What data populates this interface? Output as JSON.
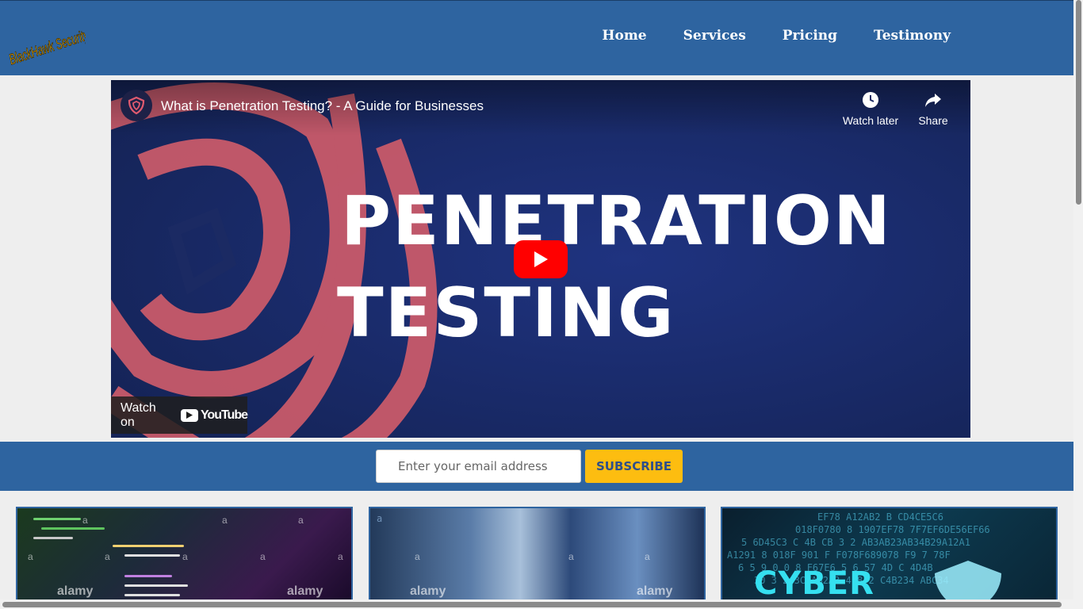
{
  "header": {
    "logo_text": "BlackHawk Security",
    "nav": [
      "Home",
      "Services",
      "Pricing",
      "Testimony"
    ]
  },
  "video": {
    "title": "What is Penetration Testing? - A Guide for Businesses",
    "watch_later": "Watch later",
    "share": "Share",
    "headline_line1": "PENETRATION",
    "headline_line2": "TESTING",
    "watch_on": "Watch on",
    "youtube": "YouTube",
    "play_icon": "play-icon",
    "clock_icon": "clock-icon",
    "share_icon": "share-arrow-icon"
  },
  "subscribe": {
    "placeholder": "Enter your email address",
    "button": "SUBSCRIBE"
  },
  "cards": {
    "watermark": "a",
    "alamy": "alamy",
    "card3_text": "CYBER",
    "hex_rows": [
      "EF78   A12AB2 B   CD4CE5C6  ",
      "018F0780 8 1907EF78 7F7EF6DE56EF66 ",
      "5   6D45C3 C 4B CB 3  2 AB3AB23AB34B29A12A1 ",
      "A1291 8 018F 901  F F078F689078 F9 7  78F",
      "6  5  9 0   0   8 F67E6 5 6 57 4D C 4D4B",
      "30 3 2 3C3AB2A3 4   8  2   C4B234  ABC34"
    ]
  },
  "colors": {
    "header_bg": "#2e64a0",
    "accent": "#fdbd10",
    "play_red": "#ff0000"
  }
}
